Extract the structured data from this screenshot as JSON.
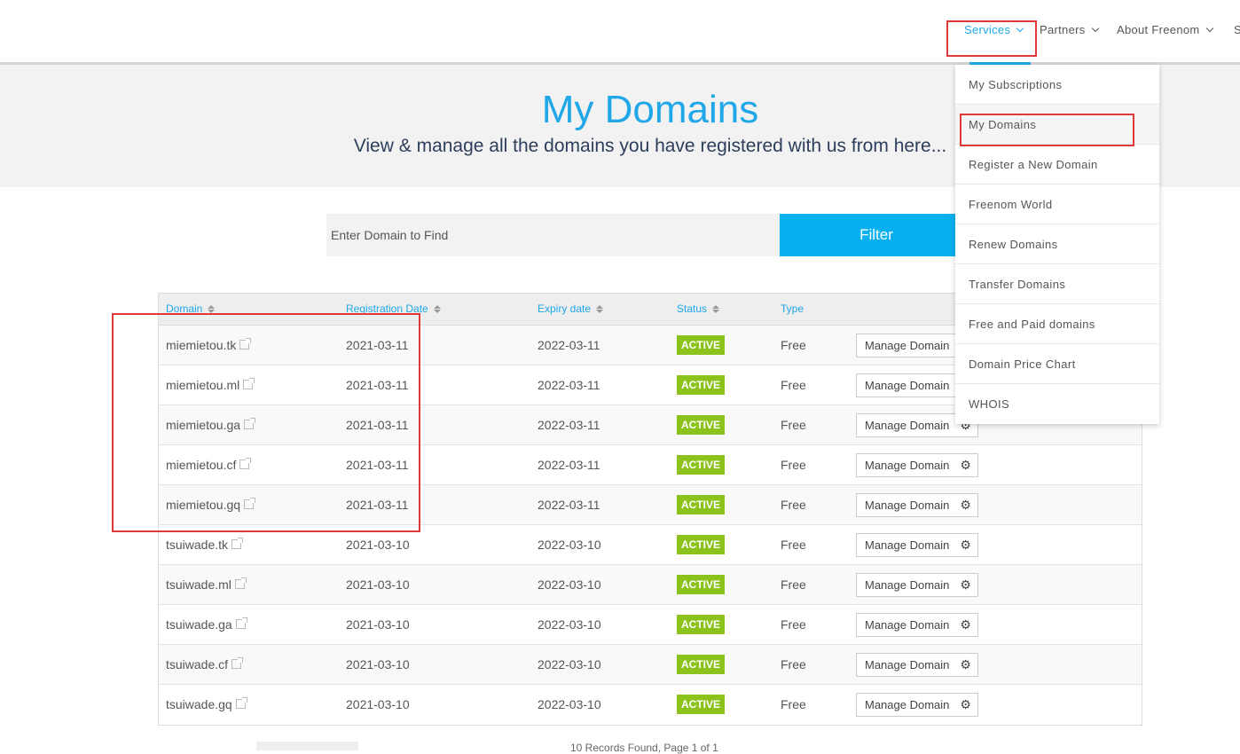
{
  "nav": {
    "items": [
      "Services",
      "Partners",
      "About Freenom",
      "S"
    ],
    "active": "Services"
  },
  "hero": {
    "title": "My Domains",
    "subtitle": "View & manage all the domains you have registered with us from here..."
  },
  "search": {
    "placeholder": "Enter Domain to Find",
    "filter_label": "Filter"
  },
  "table": {
    "columns": [
      "Domain",
      "Registration Date",
      "Expiry date",
      "Status",
      "Type"
    ],
    "rows": [
      {
        "domain": "miemietou.tk",
        "reg": "2021-03-11",
        "exp": "2022-03-11",
        "status": "ACTIVE",
        "type": "Free",
        "action": "Manage Domain"
      },
      {
        "domain": "miemietou.ml",
        "reg": "2021-03-11",
        "exp": "2022-03-11",
        "status": "ACTIVE",
        "type": "Free",
        "action": "Manage Domain"
      },
      {
        "domain": "miemietou.ga",
        "reg": "2021-03-11",
        "exp": "2022-03-11",
        "status": "ACTIVE",
        "type": "Free",
        "action": "Manage Domain"
      },
      {
        "domain": "miemietou.cf",
        "reg": "2021-03-11",
        "exp": "2022-03-11",
        "status": "ACTIVE",
        "type": "Free",
        "action": "Manage Domain"
      },
      {
        "domain": "miemietou.gq",
        "reg": "2021-03-11",
        "exp": "2022-03-11",
        "status": "ACTIVE",
        "type": "Free",
        "action": "Manage Domain"
      },
      {
        "domain": "tsuiwade.tk",
        "reg": "2021-03-10",
        "exp": "2022-03-10",
        "status": "ACTIVE",
        "type": "Free",
        "action": "Manage Domain"
      },
      {
        "domain": "tsuiwade.ml",
        "reg": "2021-03-10",
        "exp": "2022-03-10",
        "status": "ACTIVE",
        "type": "Free",
        "action": "Manage Domain"
      },
      {
        "domain": "tsuiwade.ga",
        "reg": "2021-03-10",
        "exp": "2022-03-10",
        "status": "ACTIVE",
        "type": "Free",
        "action": "Manage Domain"
      },
      {
        "domain": "tsuiwade.cf",
        "reg": "2021-03-10",
        "exp": "2022-03-10",
        "status": "ACTIVE",
        "type": "Free",
        "action": "Manage Domain"
      },
      {
        "domain": "tsuiwade.gq",
        "reg": "2021-03-10",
        "exp": "2022-03-10",
        "status": "ACTIVE",
        "type": "Free",
        "action": "Manage Domain"
      }
    ],
    "footer": "10 Records Found, Page 1 of 1"
  },
  "dropdown": {
    "items": [
      "My Subscriptions",
      "My Domains",
      "Register a New Domain",
      "Freenom World",
      "Renew Domains",
      "Transfer Domains",
      "Free and Paid domains",
      "Domain Price Chart",
      "WHOIS"
    ]
  },
  "colors": {
    "accent": "#1fa7e8",
    "filter_button": "#09b0f0",
    "status_active": "#8cc21c",
    "annotation": "#e0393a"
  },
  "icons": [
    "external-link-icon",
    "gear-icon",
    "sort-icon",
    "chevron-down-icon"
  ]
}
